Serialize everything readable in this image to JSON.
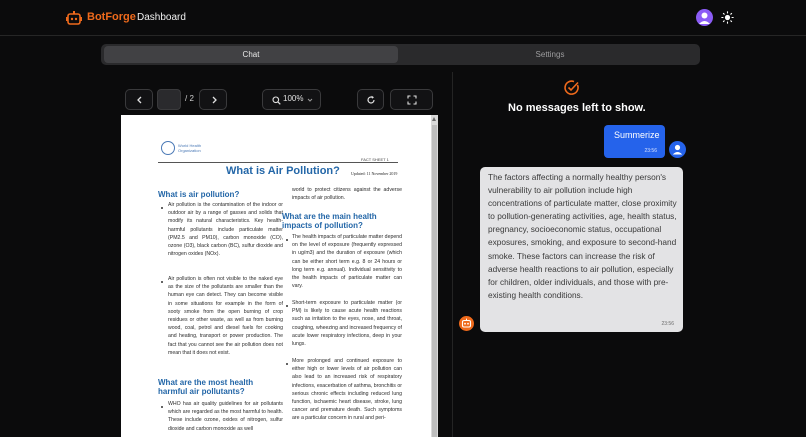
{
  "app": {
    "brand": "BotForge",
    "nav": "Dashboard"
  },
  "tabs": [
    {
      "label": "Chat",
      "active": true
    },
    {
      "label": "Settings",
      "active": false
    }
  ],
  "pdf_toolbar": {
    "page_value": "",
    "page_total": "/ 2",
    "zoom": "100%"
  },
  "pdf": {
    "org_name": "World Health Organization",
    "fact_sheet": "FACT SHEET 1",
    "title": "What is Air Pollution?",
    "updated": "Updated: 11 November 2019",
    "sections": [
      {
        "heading": "What is air pollution?"
      },
      {
        "heading": "What are the most health harmful air pollutants?"
      },
      {
        "heading": "What are the main health impacts of pollution?"
      }
    ],
    "col1_p1": "Air pollution is the contamination of the indoor or outdoor air by a range of gasses and solids that modify its natural characteristics. Key health-harmful pollutants include particulate matter (PM2.5 and PM10), carbon monoxide (CO), ozone (O3), black carbon (BC), sulfur dioxide and nitrogen oxides (NOx).",
    "col1_p2": "Air pollution is often not visible to the naked eye as the size of the pollutants are smaller than the human eye can detect. They can become visible in some situations for example in the form of sooty smoke from the open burning of crop residues or other waste, as well as from burning wood, coal, petrol and diesel fuels for cooking and heating, transport or power production. The fact that you cannot see the air pollution does not mean that it does not exist.",
    "col1_p3": "WHO has air quality guidelines for air pollutants which are regarded as the most harmful to health. These include ozone, oxides of nitrogen, sulfur dioxide and carbon monoxide as well",
    "col2_intro": "world to protect citizens against the adverse impacts of air pollution.",
    "col2_p1": "The health impacts of particulate matter depend on the level of exposure (frequently expressed in ug/m3) and the duration of exposure (which can be either short term e.g. 8 or 24 hours or long term e.g. annual). Individual sensitivity to the health impacts of particulate matter can vary.",
    "col2_p2": "Short-term exposure to particulate matter (or PM) is likely to cause acute health reactions such as irritation to the eyes, nose, and throat, coughing, wheezing and increased frequency of acute lower respiratory infections, deep in your lungs.",
    "col2_p3": "More prolonged and continued exposure to either high or lower levels of air pollution can also lead to an increased risk of respiratory infections, exacerbation of asthma, bronchitis or serious chronic effects including reduced lung function, ischaemic heart disease, stroke, lung cancer and premature death. Such symptoms are a particular concern in rural and peri-"
  },
  "chat": {
    "empty_state": "No messages left to show.",
    "messages": [
      {
        "role": "user",
        "text": "Summerize",
        "time": "23:56"
      },
      {
        "role": "bot",
        "text": "The factors affecting a normally healthy person's vulnerability to air pollution include high concentrations of particulate matter, close proximity to pollution-generating activities, age, health status, pregnancy, socioeconomic status, occupational exposures, smoking, and exposure to second-hand smoke. These factors can increase the risk of adverse health reactions to air pollution, especially for children, older individuals, and those with pre-existing health conditions.",
        "time": "23:56"
      }
    ]
  },
  "colors": {
    "accent": "#ef6a1c",
    "user_bubble": "#2563eb",
    "bot_bubble": "#e3e3e5",
    "pdf_heading": "#2467a8"
  }
}
